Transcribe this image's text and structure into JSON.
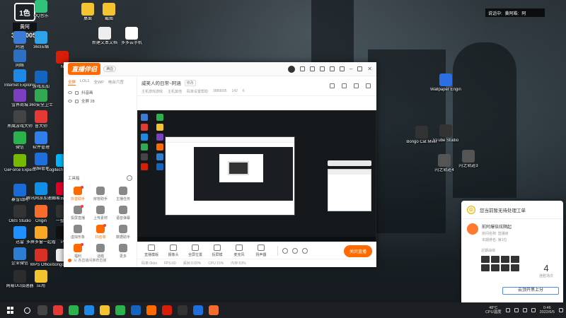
{
  "overlay": {
    "logo_text": "1色",
    "streamer_name": "黄阿",
    "room_number": "3889005"
  },
  "top_banner": {
    "label1": "说话中:",
    "label2": "黄阿皓:",
    "label3": "阿"
  },
  "desktop_icons": [
    {
      "label": "阿涵",
      "color": "#3a7bd5"
    },
    {
      "label": "网络",
      "color": "#2d6fc0"
    },
    {
      "label": "Internet Explorer",
      "color": "#1e88e5"
    },
    {
      "label": "雪界商城",
      "color": "#7b3fbf"
    },
    {
      "label": "黑鹰游戏大师",
      "color": "#444"
    },
    {
      "label": "微信",
      "color": "#2bb24c"
    },
    {
      "label": "GeForce Experience",
      "color": "#76b900"
    },
    {
      "label": "暴雪战网",
      "color": "#1a6bd6"
    },
    {
      "label": "OBS Studio",
      "color": "#333"
    },
    {
      "label": "迅雷",
      "color": "#1e90ff"
    },
    {
      "label": "企业微信",
      "color": "#2d7dd2"
    },
    {
      "label": "网易UU加速器",
      "color": "#2c2c2c"
    },
    {
      "label": "QQ音乐",
      "color": "#31c27c"
    },
    {
      "label": "360压缩",
      "color": "#2ea1e8"
    },
    {
      "label": "N",
      "color": "#d81e06"
    },
    {
      "label": "游戏加加",
      "color": "#1565c0"
    },
    {
      "label": "360安全卫士",
      "color": "#33a852"
    },
    {
      "label": "鲁大师",
      "color": "#e53935"
    },
    {
      "label": "软件管理",
      "color": "#2f80ed"
    },
    {
      "label": "电脑管家",
      "color": "#1e6fdb"
    },
    {
      "label": "腾讯网游加速器",
      "color": "#0f8fe6"
    },
    {
      "label": "Origin",
      "color": "#f56c2d"
    },
    {
      "label": "多屏多窗一起看",
      "color": "#f9a825"
    },
    {
      "label": "WPS Office",
      "color": "#d93025"
    },
    {
      "label": "桌面",
      "color": "#f4c430"
    },
    {
      "label": "截图",
      "color": "#f4c430"
    },
    {
      "label": "新建文本文档",
      "color": "#eee"
    },
    {
      "label": "多多云手机",
      "color": "#fff"
    },
    {
      "label": "Logitech G HUB",
      "color": "#00b8fc"
    },
    {
      "label": "网易云音乐",
      "color": "#e60026"
    },
    {
      "label": "一整天",
      "color": "#333"
    },
    {
      "label": "P",
      "color": "#111"
    },
    {
      "label": "bongo_cat",
      "color": "#eee"
    },
    {
      "label": "应用",
      "color": "#f4c430"
    },
    {
      "label": "Wallpaper Engine",
      "color": "#2b6ee6"
    },
    {
      "label": "VTube Studio",
      "color": "#333"
    },
    {
      "label": "Bongo Cat Mver",
      "color": "#333"
    },
    {
      "label": "ScarletPe",
      "color": "#555"
    },
    {
      "label": "闪之轨迹4",
      "color": "#555"
    },
    {
      "label": "Mirror",
      "color": "#444"
    },
    {
      "label": "闪之轨迹3",
      "color": "#555"
    },
    {
      "label": "闪之轨迹2",
      "color": "#555"
    }
  ],
  "app": {
    "logo": "直播伴侣",
    "badge": "满血",
    "scene_tabs": [
      "全屏",
      "LOL1",
      "全WP",
      "电台六宫"
    ],
    "scenes": [
      {
        "label": "抖音画"
      },
      {
        "label": "全屏 28"
      }
    ],
    "tools_title": "工具箱",
    "tools": [
      {
        "label": "抖音助手",
        "active": true,
        "dot": true,
        "color": "#ff6a00"
      },
      {
        "label": "房管助手",
        "active": false,
        "dot": false,
        "color": "#888"
      },
      {
        "label": "主播任务",
        "active": false,
        "dot": false,
        "color": "#888"
      },
      {
        "label": "投屏直播",
        "active": false,
        "dot": true,
        "color": "#888"
      },
      {
        "label": "上传素材",
        "active": false,
        "dot": false,
        "color": "#888"
      },
      {
        "label": "语音弹幕",
        "active": false,
        "dot": false,
        "color": "#888"
      },
      {
        "label": "虚拟形象",
        "active": false,
        "dot": false,
        "color": "#888"
      },
      {
        "label": "抖音商",
        "active": true,
        "dot": true,
        "color": "#ff6a00"
      },
      {
        "label": "数据助手",
        "active": false,
        "dot": false,
        "color": "#888"
      },
      {
        "label": "福利",
        "active": false,
        "dot": true,
        "color": "#ff6a00"
      },
      {
        "label": "话题",
        "active": false,
        "dot": false,
        "color": "#888"
      },
      {
        "label": "更多",
        "active": false,
        "dot": false,
        "color": "#888"
      }
    ],
    "left_footer": "从 各直播间推荐直播",
    "room": {
      "title": "威笑人的日常~阿涵",
      "tag": "修改",
      "sub": [
        "主机游戏游戏",
        "主机其他",
        "码率设置帮助",
        "3889005",
        "142",
        "6"
      ]
    },
    "controls": [
      {
        "label": "直播模版"
      },
      {
        "label": "摄像头"
      },
      {
        "label": "全屏位置"
      },
      {
        "label": "投屏模"
      },
      {
        "label": "麦克风"
      },
      {
        "label": "扬声器"
      }
    ],
    "live_button": "关闭直播",
    "status": [
      "码率:0kbs",
      "FPS:60",
      "丢帧:0.00%",
      "CPU:15%",
      "内存:53%"
    ]
  },
  "notification": {
    "top_text": "您当前暂无待处理工单",
    "user_name": "前阿爆倍炫隔起",
    "user_sub1": "房间名称: 直播房",
    "user_sub2": "本期排名: 第1位",
    "section": "近期战绩",
    "count": "4",
    "count_label": "连胜场次",
    "button": "云顶开黑上分"
  },
  "taskbar": {
    "temp": "48°C",
    "temp_label": "CPU温度",
    "time": "0:46",
    "date": "2022/6/5"
  }
}
